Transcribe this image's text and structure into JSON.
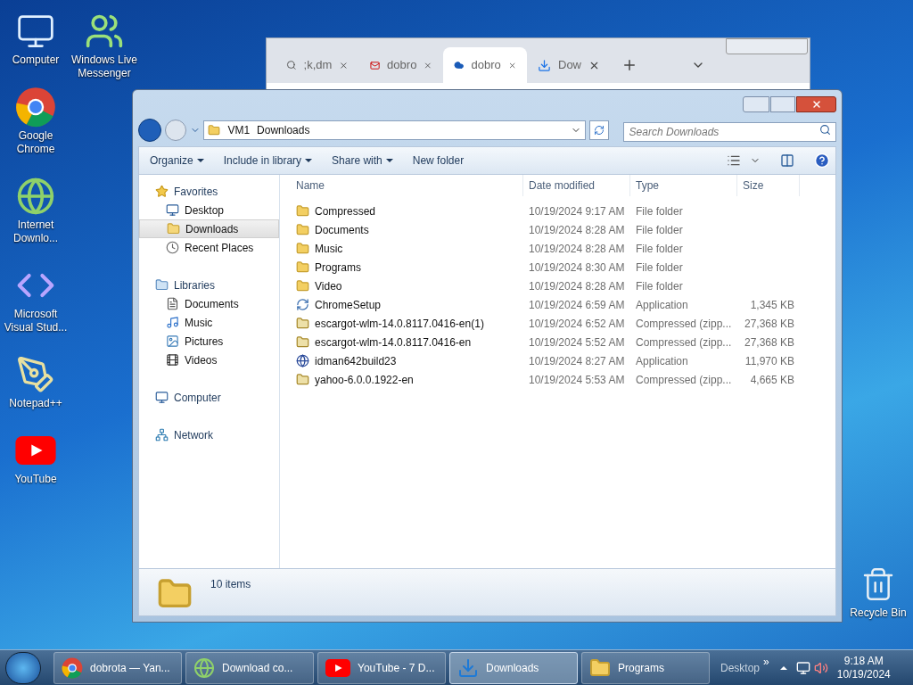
{
  "desktop_icons": [
    {
      "label": "Computer",
      "kind": "computer"
    },
    {
      "label": "Windows Live Messenger",
      "kind": "messenger"
    },
    {
      "label": "Google Chrome",
      "kind": "chrome"
    },
    {
      "label": "Internet Downlo...",
      "kind": "idm"
    },
    {
      "label": "Microsoft Visual Stud...",
      "kind": "vs"
    },
    {
      "label": "Notepad++",
      "kind": "notepad"
    },
    {
      "label": "YouTube",
      "kind": "youtube"
    },
    {
      "label": "Recycle Bin",
      "kind": "recycle"
    }
  ],
  "browser": {
    "tabs": [
      {
        "label": ";k,dm",
        "kind": "search",
        "selected": false
      },
      {
        "label": "dobro",
        "kind": "mail",
        "selected": false
      },
      {
        "label": "dobro",
        "kind": "cloud",
        "selected": true
      },
      {
        "label": "Dow",
        "kind": "download",
        "selected": false
      }
    ]
  },
  "explorer": {
    "breadcrumb": [
      "VM1",
      "Downloads"
    ],
    "search": {
      "placeholder": "Search Downloads"
    },
    "toolbar": [
      {
        "label": "Organize",
        "dropdown": true
      },
      {
        "label": "Include in library",
        "dropdown": true
      },
      {
        "label": "Share with",
        "dropdown": true
      },
      {
        "label": "New folder",
        "dropdown": false
      }
    ],
    "nav": [
      {
        "label": "Favorites",
        "kind": "star",
        "selected": false,
        "children": [
          {
            "label": "Desktop",
            "kind": "desktop",
            "selected": false
          },
          {
            "label": "Downloads",
            "kind": "downloads",
            "selected": true
          },
          {
            "label": "Recent Places",
            "kind": "recent",
            "selected": false
          }
        ]
      },
      {
        "label": "Libraries",
        "kind": "library",
        "selected": false,
        "children": [
          {
            "label": "Documents",
            "kind": "document",
            "selected": false
          },
          {
            "label": "Music",
            "kind": "music",
            "selected": false
          },
          {
            "label": "Pictures",
            "kind": "picture",
            "selected": false
          },
          {
            "label": "Videos",
            "kind": "video",
            "selected": false
          }
        ]
      },
      {
        "label": "Computer",
        "kind": "computer",
        "selected": false
      },
      {
        "label": "Network",
        "kind": "network",
        "selected": false
      }
    ],
    "columns": [
      "Name",
      "Date modified",
      "Type",
      "Size"
    ],
    "rows": [
      {
        "name": "Compressed",
        "date": "10/19/2024 9:17 AM",
        "type": "File folder",
        "size": "",
        "kind": "folder"
      },
      {
        "name": "Documents",
        "date": "10/19/2024 8:28 AM",
        "type": "File folder",
        "size": "",
        "kind": "folder"
      },
      {
        "name": "Music",
        "date": "10/19/2024 8:28 AM",
        "type": "File folder",
        "size": "",
        "kind": "folder"
      },
      {
        "name": "Programs",
        "date": "10/19/2024 8:30 AM",
        "type": "File folder",
        "size": "",
        "kind": "folder"
      },
      {
        "name": "Video",
        "date": "10/19/2024 8:28 AM",
        "type": "File folder",
        "size": "",
        "kind": "folder"
      },
      {
        "name": "ChromeSetup",
        "date": "10/19/2024 6:59 AM",
        "type": "Application",
        "size": "1,345 KB",
        "kind": "setup"
      },
      {
        "name": "escargot-wlm-14.0.8117.0416-en(1)",
        "date": "10/19/2024 6:52 AM",
        "type": "Compressed (zipp...",
        "size": "27,368 KB",
        "kind": "zip"
      },
      {
        "name": "escargot-wlm-14.0.8117.0416-en",
        "date": "10/19/2024 5:52 AM",
        "type": "Compressed (zipp...",
        "size": "27,368 KB",
        "kind": "zip"
      },
      {
        "name": "idman642build23",
        "date": "10/19/2024 8:27 AM",
        "type": "Application",
        "size": "11,970 KB",
        "kind": "app"
      },
      {
        "name": "yahoo-6.0.0.1922-en",
        "date": "10/19/2024 5:53 AM",
        "type": "Compressed (zipp...",
        "size": "4,665 KB",
        "kind": "zip"
      }
    ],
    "status": "10 items"
  },
  "taskbar": {
    "items": [
      {
        "label": "dobrota — Yan...",
        "kind": "chrome",
        "selected": false
      },
      {
        "label": "Download co...",
        "kind": "idm",
        "selected": false
      },
      {
        "label": "YouTube - 7 D...",
        "kind": "youtube",
        "selected": false
      },
      {
        "label": "Downloads",
        "kind": "downloads",
        "selected": true
      },
      {
        "label": "Programs",
        "kind": "folder",
        "selected": false
      }
    ],
    "toolbar_label": "Desktop",
    "chevron": "»",
    "time": "9:18 AM",
    "date": "10/19/2024"
  }
}
